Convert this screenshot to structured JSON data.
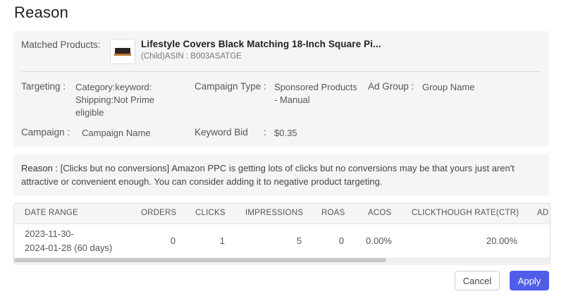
{
  "dialog": {
    "title": "Reason"
  },
  "info": {
    "matched_products_label": "Matched Products:",
    "product_image": "bed-thumbnail",
    "product_name": "Lifestyle Covers Black Matching 18-Inch Square Pi...",
    "product_asin": "(Child)ASIN : B003ASATGE",
    "targeting_label": "Targeting :",
    "targeting_value": "Category:keyword: Shipping:Not Prime eligible",
    "campaign_type_label": "Campaign Type :",
    "campaign_type_value": "Sponsored Products - Manual",
    "ad_group_label": "Ad Group :",
    "ad_group_value": "Group Name",
    "campaign_label": "Campaign :",
    "campaign_value": "Campaign Name",
    "keyword_bid_label": "Keyword Bid",
    "keyword_bid_colon": ":",
    "keyword_bid_value": "$0.35"
  },
  "reason": {
    "label": "Reason :",
    "text": "[Clicks but no conversions] Amazon PPC is getting lots of clicks but no conversions may be that yours just aren't attractive or convenient enough. You can consider adding it to negative product targeting."
  },
  "table": {
    "columns": [
      "DATE RANGE",
      "ORDERS",
      "CLICKS",
      "IMPRESSIONS",
      "ROAS",
      "ACOS",
      "CLICKTHOUGH RATE(CTR)",
      "AD"
    ],
    "rows": [
      {
        "date_line1": "2023-11-30-",
        "date_line2": "2024-01-28 (60 days)",
        "orders": "0",
        "clicks": "1",
        "impressions": "5",
        "roas": "0",
        "acos": "0.00%",
        "ctr": "20.00%"
      }
    ]
  },
  "actions": {
    "cancel_label": "Cancel",
    "apply_label": "Apply"
  },
  "colors": {
    "primary": "#4f5de8",
    "panel_bg": "#f5f5f5"
  }
}
